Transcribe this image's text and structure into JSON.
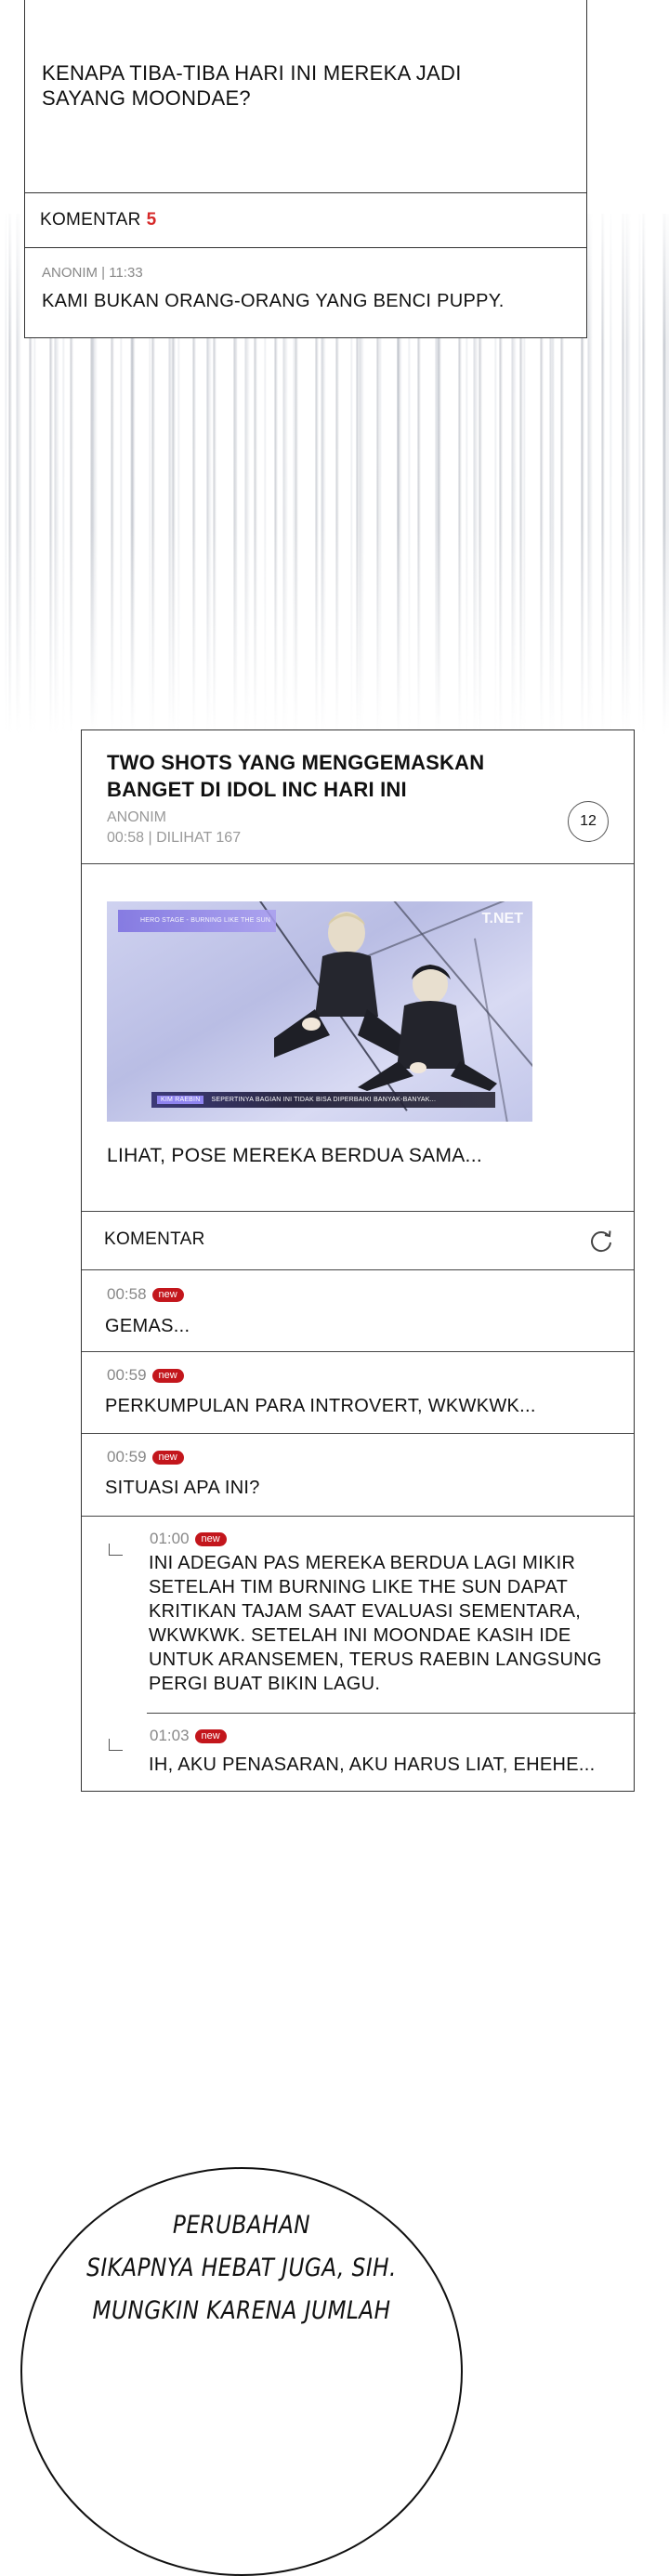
{
  "top_post": {
    "body": "KENAPA TIBA-TIBA HARI INI MEREKA JADI SAYANG MOONDAE?",
    "comment_label": "KOMENTAR",
    "comment_count": "5",
    "comment": {
      "meta": "ANONIM | 11:33",
      "text": "KAMI BUKAN ORANG-ORANG YANG BENCI PUPPY."
    }
  },
  "main_post": {
    "title": "TWO SHOTS YANG MENGGEMASKAN BANGET DI IDOL INC HARI INI",
    "author": "ANONIM",
    "meta": "00:58 | DILIHAT 167",
    "comment_count": "12",
    "image": {
      "logo": "T.NET",
      "top_tag": "HERO STAGE - BURNING LIKE THE SUN",
      "caption_name": "KIM RAEBIN",
      "caption_text": "SEPERTINYA BAGIAN INI TIDAK BISA DIPERBAIKI BANYAK-BANYAK..."
    },
    "body": "LIHAT, POSE MEREKA BERDUA SAMA...",
    "comments_label": "KOMENTAR",
    "new_badge": "new",
    "comments": [
      {
        "time": "00:58",
        "text": "GEMAS..."
      },
      {
        "time": "00:59",
        "text": "PERKUMPULAN PARA INTROVERT, WKWKWK..."
      },
      {
        "time": "00:59",
        "text": "SITUASI APA INI?"
      }
    ],
    "replies": [
      {
        "time": "01:00",
        "text": "INI ADEGAN PAS MEREKA BERDUA LAGI MIKIR SETELAH TIM BURNING LIKE THE SUN DAPAT KRITIKAN TAJAM SAAT EVALUASI SEMENTARA, WKWKWK. SETELAH INI MOONDAE KASIH IDE UNTUK ARANSEMEN, TERUS RAEBIN LANGSUNG PERGI BUAT BIKIN LAGU."
      },
      {
        "time": "01:03",
        "text": "IH, AKU PENASARAN, AKU HARUS LIAT, EHEHE..."
      }
    ]
  },
  "bubble": {
    "lines": [
      "PERUBAHAN",
      "SIKAPNYA HEBAT JUGA, SIH.",
      "MUNGKIN KARENA JUMLAH"
    ]
  },
  "colors": {
    "accent_red": "#c3161c",
    "count_red": "#d62a2a",
    "border": "#333333",
    "muted_text": "#888888"
  },
  "icons": [
    "refresh-icon",
    "reply-arrow-icon"
  ]
}
